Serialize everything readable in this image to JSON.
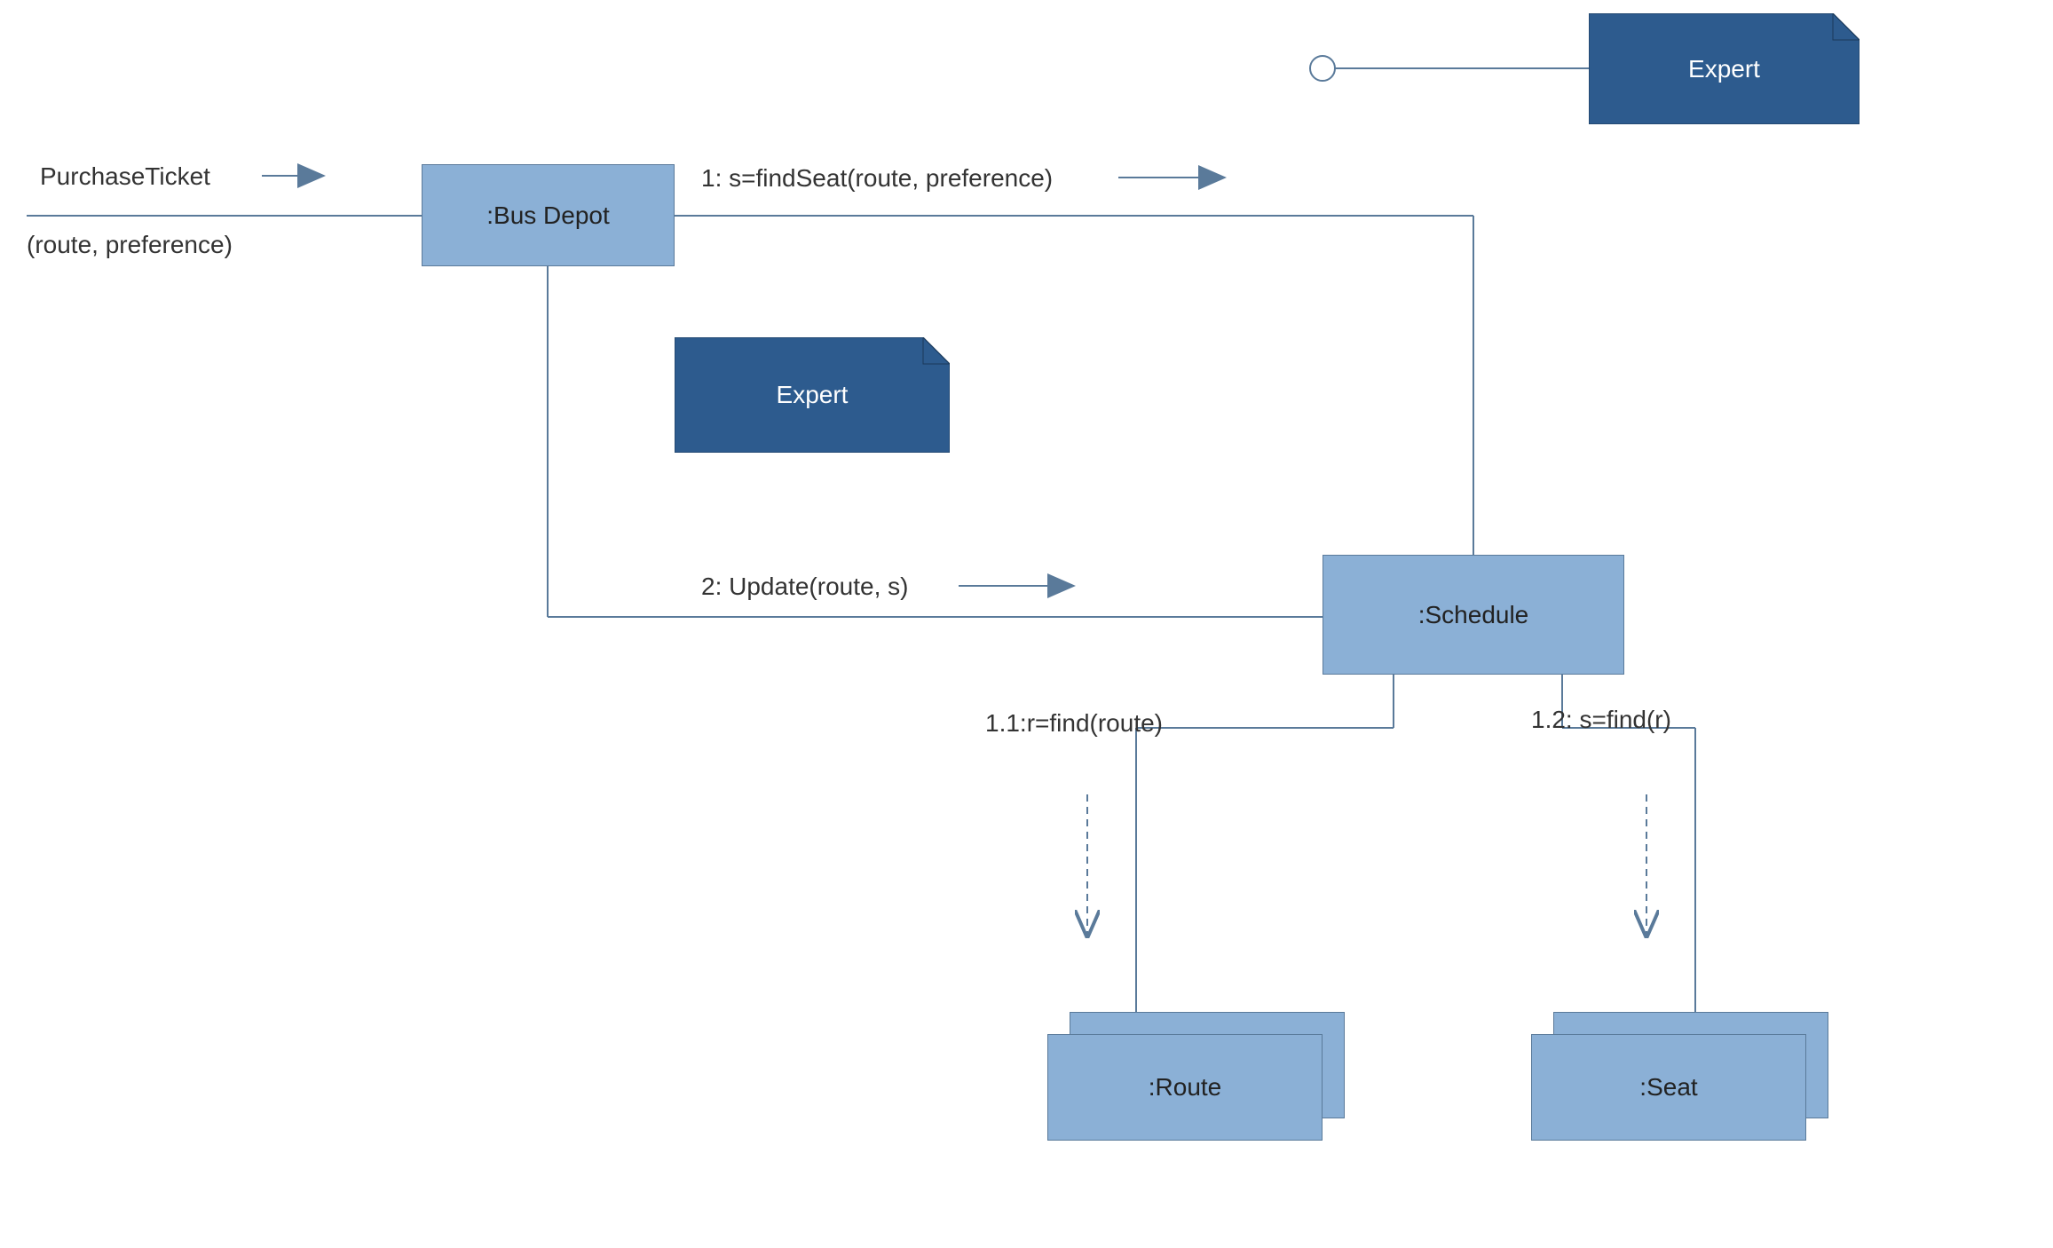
{
  "nodes": {
    "busDepot": ":Bus Depot",
    "schedule": ":Schedule",
    "route": ":Route",
    "seat": ":Seat"
  },
  "notes": {
    "expert1": "Expert",
    "expert2": "Expert"
  },
  "messages": {
    "purchaseTicket": "PurchaseTicket",
    "routePreference": "(route, preference)",
    "findSeat": "1: s=findSeat(route, preference)",
    "update": "2: Update(route, s)",
    "findRoute": "1.1:r=find(route)",
    "findSeat2": "1.2: s=find(r)"
  }
}
